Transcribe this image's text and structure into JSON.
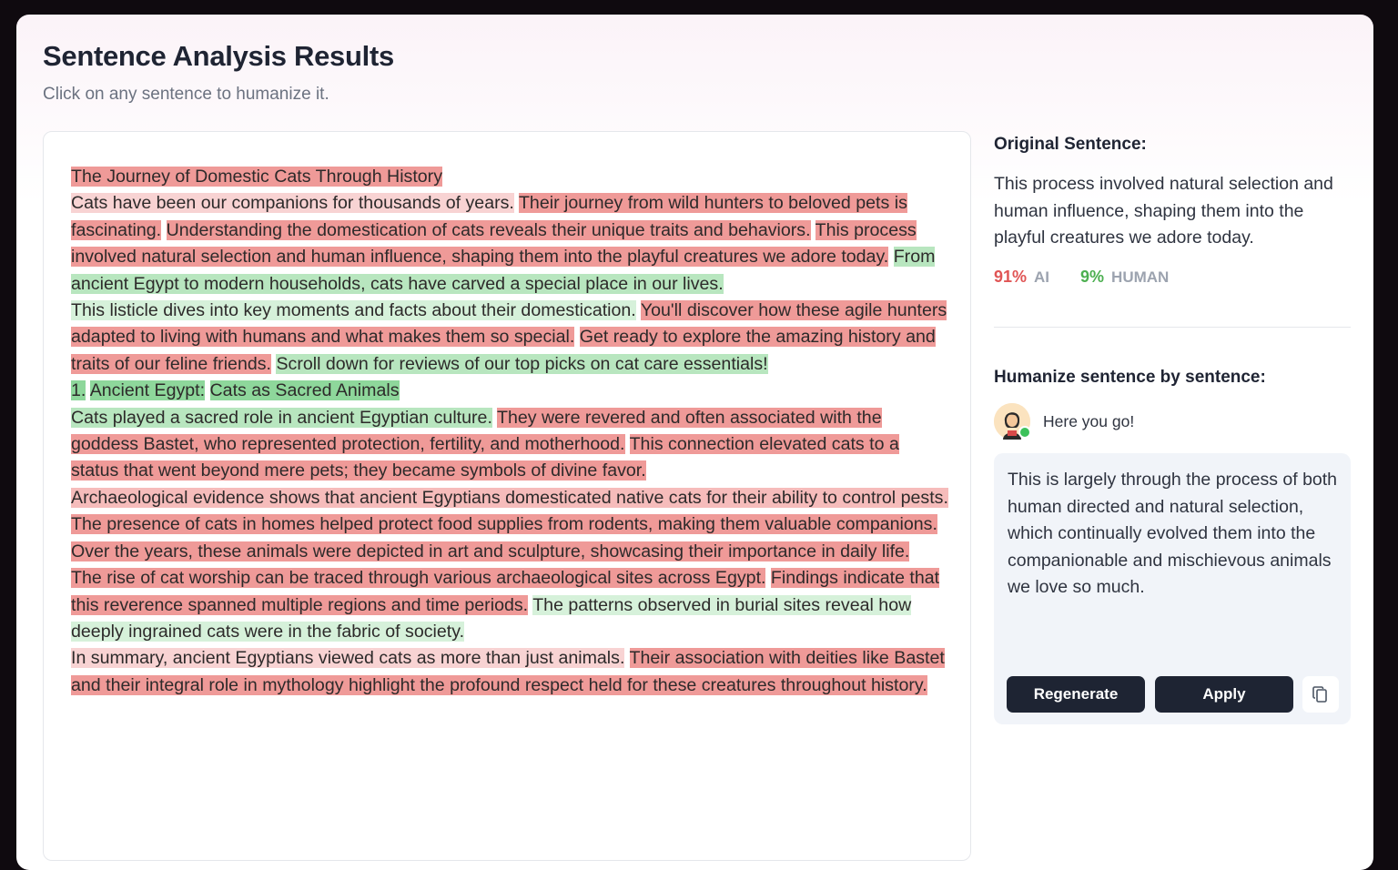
{
  "header": {
    "title": "Sentence Analysis Results",
    "subtitle": "Click on any sentence to humanize it."
  },
  "sentences": [
    "The Journey of Domestic Cats Through History",
    "Cats have been our companions for thousands of years.",
    "Their journey from wild hunters to beloved pets is fascinating.",
    "Understanding the domestication of cats reveals their unique traits and behaviors.",
    "This process involved natural selection and human influence, shaping them into the playful creatures we adore today.",
    "From ancient Egypt to modern households, cats have carved a special place in our lives.",
    "This listicle dives into key moments and facts about their domestication.",
    "You'll discover how these agile hunters adapted to living with humans and what makes them so special.",
    "Get ready to explore the amazing history and traits of our feline friends.",
    "Scroll down for reviews of our top picks on cat care essentials!",
    "1.",
    "Ancient Egypt:",
    "Cats as Sacred Animals",
    "Cats played a sacred role in ancient Egyptian culture.",
    "They were revered and often associated with the goddess Bastet, who represented protection, fertility, and motherhood.",
    "This connection elevated cats to a status that went beyond mere pets; they became symbols of divine favor.",
    "Archaeological evidence shows that ancient Egyptians domesticated native cats for their ability to control pests.",
    "The presence of cats in homes helped protect food supplies from rodents, making them valuable companions.",
    "Over the years, these animals were depicted in art and sculpture, showcasing their importance in daily life.",
    "The rise of cat worship can be traced through various archaeological sites across Egypt.",
    "Findings indicate that this reverence spanned multiple regions and time periods.",
    "The patterns observed in burial sites reveal how deeply ingrained cats were in the fabric of society.",
    "In summary, ancient Egyptians viewed cats as more than just animals.",
    "Their association with deities like Bastet and their integral role in mythology highlight the profound respect held for these creatures throughout history."
  ],
  "sidebar": {
    "original_label": "Original Sentence:",
    "original_text": "This process involved natural selection and human influence, shaping them into the playful creatures we adore today.",
    "ai_score": "91%",
    "ai_label": "AI",
    "human_score": "9%",
    "human_label": "HUMAN",
    "humanize_label": "Humanize sentence by sentence:",
    "bot_message": "Here you go!",
    "suggestion": "This is largely through the process of both human directed and natural selection, which continually evolved them into the companionable and mischievous animals we love so much.",
    "regenerate_label": "Regenerate",
    "apply_label": "Apply"
  },
  "colors": {
    "ai_high": "#ef9a98",
    "ai_mid": "#f6bcbb",
    "ai_low": "#f8d3d3",
    "human_high": "#8ed79b",
    "human_mid": "#b8e6bf",
    "human_low": "#d6f1da",
    "button": "#1e2433",
    "ai_score": "#e05555",
    "human_score": "#4caf50"
  }
}
